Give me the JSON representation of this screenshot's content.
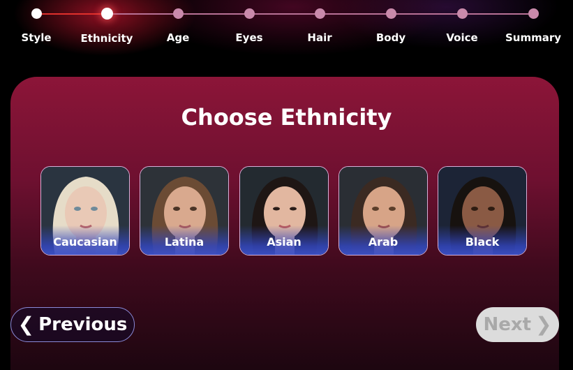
{
  "stepper": {
    "steps": [
      {
        "label": "Style",
        "state": "done"
      },
      {
        "label": "Ethnicity",
        "state": "current"
      },
      {
        "label": "Age",
        "state": "todo"
      },
      {
        "label": "Eyes",
        "state": "todo"
      },
      {
        "label": "Hair",
        "state": "todo"
      },
      {
        "label": "Body",
        "state": "todo"
      },
      {
        "label": "Voice",
        "state": "todo"
      },
      {
        "label": "Summary",
        "state": "todo"
      }
    ]
  },
  "main": {
    "title": "Choose Ethnicity",
    "options": [
      {
        "label": "Caucasian",
        "skin": "#e9c9b6",
        "hair": "#e6dcc8"
      },
      {
        "label": "Latina",
        "skin": "#d9a98e",
        "hair": "#6b4b34"
      },
      {
        "label": "Asian",
        "skin": "#e2b7a0",
        "hair": "#1e1614"
      },
      {
        "label": "Arab",
        "skin": "#d7a487",
        "hair": "#3b2a22"
      },
      {
        "label": "Black",
        "skin": "#8a5a44",
        "hair": "#17120f"
      }
    ]
  },
  "nav": {
    "previous_label": "Previous",
    "next_label": "Next",
    "prev_icon": "chevron-left-icon",
    "next_icon": "chevron-right-icon"
  },
  "colors": {
    "accent": "#e0302c",
    "card_top": "#8c1538",
    "step_inactive": "#c98aab"
  }
}
